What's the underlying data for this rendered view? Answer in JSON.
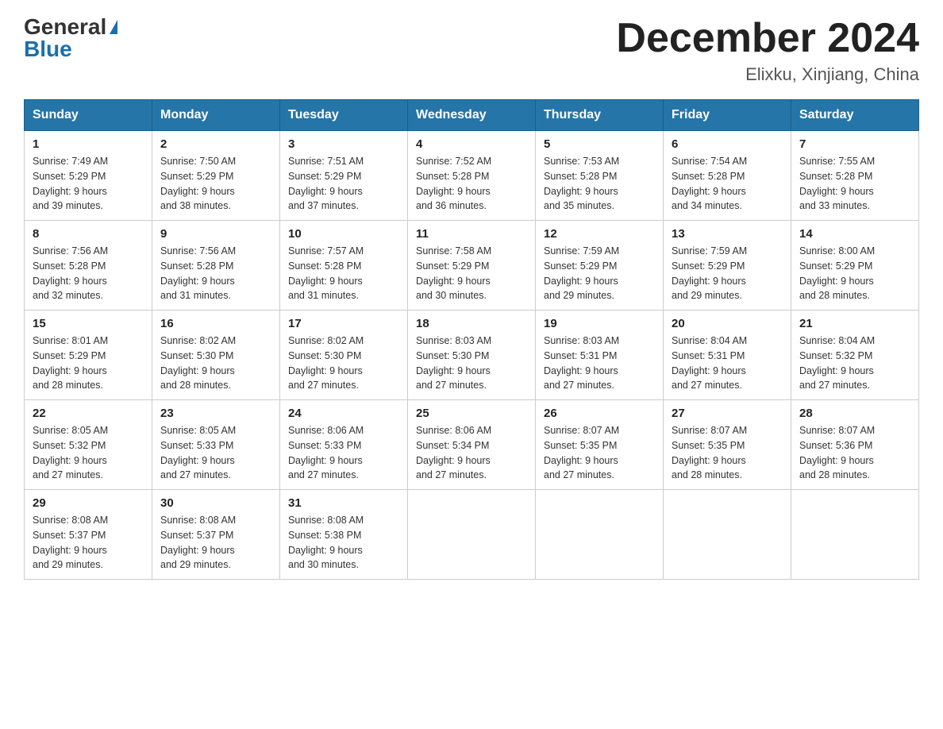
{
  "header": {
    "logo_general": "General",
    "logo_blue": "Blue",
    "month_title": "December 2024",
    "location": "Elixku, Xinjiang, China"
  },
  "weekdays": [
    "Sunday",
    "Monday",
    "Tuesday",
    "Wednesday",
    "Thursday",
    "Friday",
    "Saturday"
  ],
  "weeks": [
    [
      {
        "day": "1",
        "sunrise": "7:49 AM",
        "sunset": "5:29 PM",
        "daylight": "9 hours and 39 minutes."
      },
      {
        "day": "2",
        "sunrise": "7:50 AM",
        "sunset": "5:29 PM",
        "daylight": "9 hours and 38 minutes."
      },
      {
        "day": "3",
        "sunrise": "7:51 AM",
        "sunset": "5:29 PM",
        "daylight": "9 hours and 37 minutes."
      },
      {
        "day": "4",
        "sunrise": "7:52 AM",
        "sunset": "5:28 PM",
        "daylight": "9 hours and 36 minutes."
      },
      {
        "day": "5",
        "sunrise": "7:53 AM",
        "sunset": "5:28 PM",
        "daylight": "9 hours and 35 minutes."
      },
      {
        "day": "6",
        "sunrise": "7:54 AM",
        "sunset": "5:28 PM",
        "daylight": "9 hours and 34 minutes."
      },
      {
        "day": "7",
        "sunrise": "7:55 AM",
        "sunset": "5:28 PM",
        "daylight": "9 hours and 33 minutes."
      }
    ],
    [
      {
        "day": "8",
        "sunrise": "7:56 AM",
        "sunset": "5:28 PM",
        "daylight": "9 hours and 32 minutes."
      },
      {
        "day": "9",
        "sunrise": "7:56 AM",
        "sunset": "5:28 PM",
        "daylight": "9 hours and 31 minutes."
      },
      {
        "day": "10",
        "sunrise": "7:57 AM",
        "sunset": "5:28 PM",
        "daylight": "9 hours and 31 minutes."
      },
      {
        "day": "11",
        "sunrise": "7:58 AM",
        "sunset": "5:29 PM",
        "daylight": "9 hours and 30 minutes."
      },
      {
        "day": "12",
        "sunrise": "7:59 AM",
        "sunset": "5:29 PM",
        "daylight": "9 hours and 29 minutes."
      },
      {
        "day": "13",
        "sunrise": "7:59 AM",
        "sunset": "5:29 PM",
        "daylight": "9 hours and 29 minutes."
      },
      {
        "day": "14",
        "sunrise": "8:00 AM",
        "sunset": "5:29 PM",
        "daylight": "9 hours and 28 minutes."
      }
    ],
    [
      {
        "day": "15",
        "sunrise": "8:01 AM",
        "sunset": "5:29 PM",
        "daylight": "9 hours and 28 minutes."
      },
      {
        "day": "16",
        "sunrise": "8:02 AM",
        "sunset": "5:30 PM",
        "daylight": "9 hours and 28 minutes."
      },
      {
        "day": "17",
        "sunrise": "8:02 AM",
        "sunset": "5:30 PM",
        "daylight": "9 hours and 27 minutes."
      },
      {
        "day": "18",
        "sunrise": "8:03 AM",
        "sunset": "5:30 PM",
        "daylight": "9 hours and 27 minutes."
      },
      {
        "day": "19",
        "sunrise": "8:03 AM",
        "sunset": "5:31 PM",
        "daylight": "9 hours and 27 minutes."
      },
      {
        "day": "20",
        "sunrise": "8:04 AM",
        "sunset": "5:31 PM",
        "daylight": "9 hours and 27 minutes."
      },
      {
        "day": "21",
        "sunrise": "8:04 AM",
        "sunset": "5:32 PM",
        "daylight": "9 hours and 27 minutes."
      }
    ],
    [
      {
        "day": "22",
        "sunrise": "8:05 AM",
        "sunset": "5:32 PM",
        "daylight": "9 hours and 27 minutes."
      },
      {
        "day": "23",
        "sunrise": "8:05 AM",
        "sunset": "5:33 PM",
        "daylight": "9 hours and 27 minutes."
      },
      {
        "day": "24",
        "sunrise": "8:06 AM",
        "sunset": "5:33 PM",
        "daylight": "9 hours and 27 minutes."
      },
      {
        "day": "25",
        "sunrise": "8:06 AM",
        "sunset": "5:34 PM",
        "daylight": "9 hours and 27 minutes."
      },
      {
        "day": "26",
        "sunrise": "8:07 AM",
        "sunset": "5:35 PM",
        "daylight": "9 hours and 27 minutes."
      },
      {
        "day": "27",
        "sunrise": "8:07 AM",
        "sunset": "5:35 PM",
        "daylight": "9 hours and 28 minutes."
      },
      {
        "day": "28",
        "sunrise": "8:07 AM",
        "sunset": "5:36 PM",
        "daylight": "9 hours and 28 minutes."
      }
    ],
    [
      {
        "day": "29",
        "sunrise": "8:08 AM",
        "sunset": "5:37 PM",
        "daylight": "9 hours and 29 minutes."
      },
      {
        "day": "30",
        "sunrise": "8:08 AM",
        "sunset": "5:37 PM",
        "daylight": "9 hours and 29 minutes."
      },
      {
        "day": "31",
        "sunrise": "8:08 AM",
        "sunset": "5:38 PM",
        "daylight": "9 hours and 30 minutes."
      },
      null,
      null,
      null,
      null
    ]
  ],
  "labels": {
    "sunrise": "Sunrise:",
    "sunset": "Sunset:",
    "daylight": "Daylight:"
  }
}
